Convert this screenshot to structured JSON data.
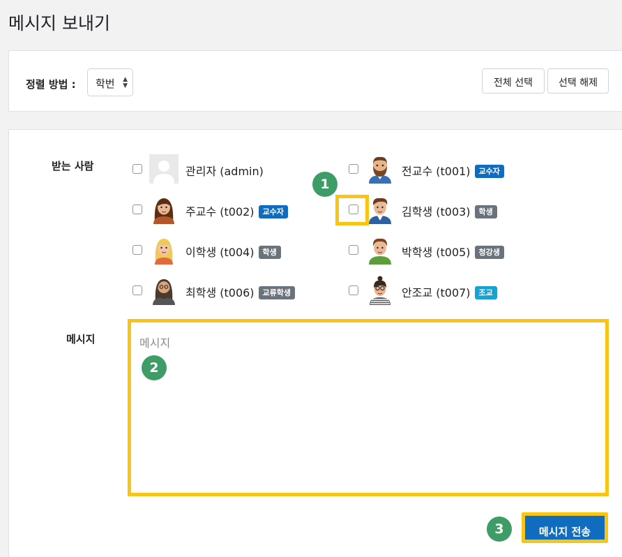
{
  "page_title": "메시지 보내기",
  "sort": {
    "label": "정렬 방법 :",
    "selected": "학번",
    "select_all": "전체 선택",
    "deselect_all": "선택 해제"
  },
  "form": {
    "recipients_label": "받는 사람",
    "message_label": "메시지",
    "message_placeholder": "메시지",
    "send_button": "메시지 전송"
  },
  "recipients": [
    {
      "name": "관리자 (admin)",
      "badge": "",
      "avatar": "default"
    },
    {
      "name": "전교수 (t001)",
      "badge": "교수자",
      "avatar": "bearded-man"
    },
    {
      "name": "주교수 (t002)",
      "badge": "교수자",
      "avatar": "brown-hair-woman"
    },
    {
      "name": "김학생 (t003)",
      "badge": "학생",
      "avatar": "young-man"
    },
    {
      "name": "이학생 (t004)",
      "badge": "학생",
      "avatar": "blonde-woman"
    },
    {
      "name": "박학생 (t005)",
      "badge": "청강생",
      "avatar": "green-shirt-man"
    },
    {
      "name": "최학생 (t006)",
      "badge": "교류학생",
      "avatar": "long-hair-man"
    },
    {
      "name": "안조교 (t007)",
      "badge": "조교",
      "avatar": "glasses-woman"
    }
  ],
  "steps": [
    "1",
    "2",
    "3"
  ],
  "colors": {
    "highlight": "#f9c514",
    "primary": "#0f6cbf",
    "step_badge": "#3e9c67",
    "role_student": "#6a737b",
    "role_ta": "#17a2cf"
  }
}
